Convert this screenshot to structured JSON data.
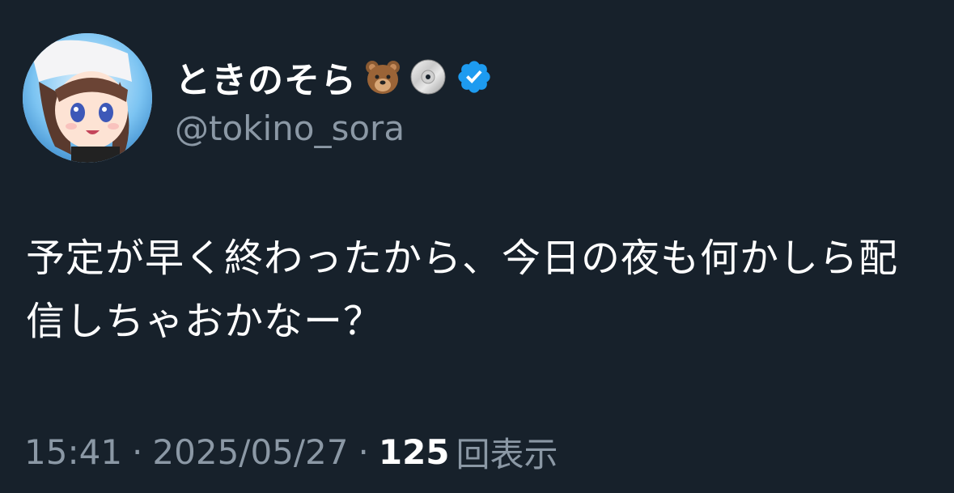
{
  "author": {
    "display_name": "ときのそら",
    "handle": "@tokino_sora",
    "name_emojis": [
      "bear-emoji",
      "disc-emoji"
    ],
    "verified": true
  },
  "tweet": {
    "text": "予定が早く終わったから、今日の夜も何かしら配信しちゃおかなー？"
  },
  "meta": {
    "time": "15:41",
    "date": "2025/05/27",
    "separator": "·",
    "views_count": "125",
    "views_label": "回表示"
  },
  "colors": {
    "background": "#17212b",
    "text_primary": "#ffffff",
    "text_secondary": "#8b98a5",
    "verified_blue": "#1d9bf0"
  }
}
